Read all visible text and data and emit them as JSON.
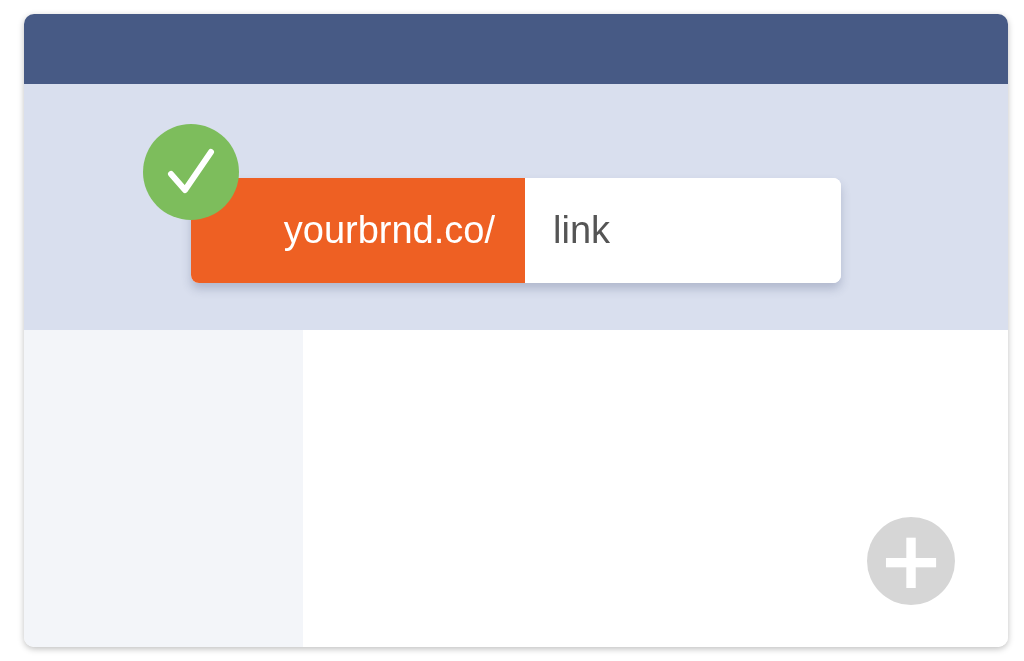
{
  "url_bar": {
    "prefix": "yourbrnd.co/",
    "value": "link",
    "verified": true
  },
  "add_button": {
    "label": "+"
  }
}
